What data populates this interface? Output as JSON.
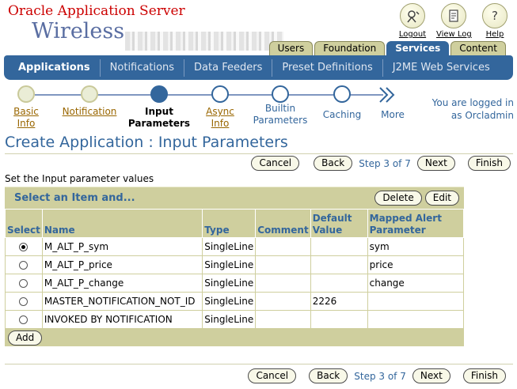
{
  "branding": {
    "line1": "Oracle Application Server",
    "line2": "Wireless"
  },
  "global_icons": [
    {
      "label": "Logout",
      "icon": "logout-icon"
    },
    {
      "label": "View Log",
      "icon": "view-log-icon"
    },
    {
      "label": "Help",
      "icon": "help-icon"
    }
  ],
  "tabs": [
    "Users",
    "Foundation",
    "Services",
    "Content"
  ],
  "active_tab": "Services",
  "global_bar": [
    "Applications",
    "Notifications",
    "Data Feeders",
    "Preset Definitions",
    "J2ME Web Services"
  ],
  "train": {
    "steps": [
      {
        "label1": "Basic",
        "label2": "Info",
        "state": "visited"
      },
      {
        "label1": "Notification",
        "label2": "",
        "state": "visited"
      },
      {
        "label1": "Input",
        "label2": "Parameters",
        "state": "current"
      },
      {
        "label1": "Async",
        "label2": "Info",
        "state": "next"
      },
      {
        "label1": "Builtin",
        "label2": "Parameters",
        "state": "unvisited"
      },
      {
        "label1": "Caching",
        "label2": "",
        "state": "unvisited"
      }
    ],
    "more_label": "More"
  },
  "login": {
    "line1": "You are logged in",
    "line2": "as Orcladmin"
  },
  "page_title": "Create Application : Input Parameters",
  "nav": {
    "cancel": "Cancel",
    "back": "Back",
    "step_info": "Step 3 of 7",
    "next": "Next",
    "finish": "Finish"
  },
  "instruction": "Set the Input parameter values",
  "table": {
    "title": "Select an Item and...",
    "actions": {
      "delete": "Delete",
      "edit": "Edit"
    },
    "headers": {
      "select": "Select",
      "name": "Name",
      "type": "Type",
      "comment": "Comment",
      "default1": "Default",
      "default2": "Value",
      "mapped1": "Mapped Alert",
      "mapped2": "Parameter"
    },
    "rows": [
      {
        "selected": true,
        "name": "M_ALT_P_sym",
        "type": "SingleLine",
        "comment": "",
        "default": "",
        "mapped": "sym"
      },
      {
        "selected": false,
        "name": "M_ALT_P_price",
        "type": "SingleLine",
        "comment": "",
        "default": "",
        "mapped": "price"
      },
      {
        "selected": false,
        "name": "M_ALT_P_change",
        "type": "SingleLine",
        "comment": "",
        "default": "",
        "mapped": "change"
      },
      {
        "selected": false,
        "name": "MASTER_NOTIFICATION_NOT_ID",
        "type": "SingleLine",
        "comment": "",
        "default": "2226",
        "mapped": ""
      },
      {
        "selected": false,
        "name": "INVOKED BY NOTIFICATION",
        "type": "SingleLine",
        "comment": "",
        "default": "",
        "mapped": ""
      }
    ],
    "add_label": "Add"
  }
}
